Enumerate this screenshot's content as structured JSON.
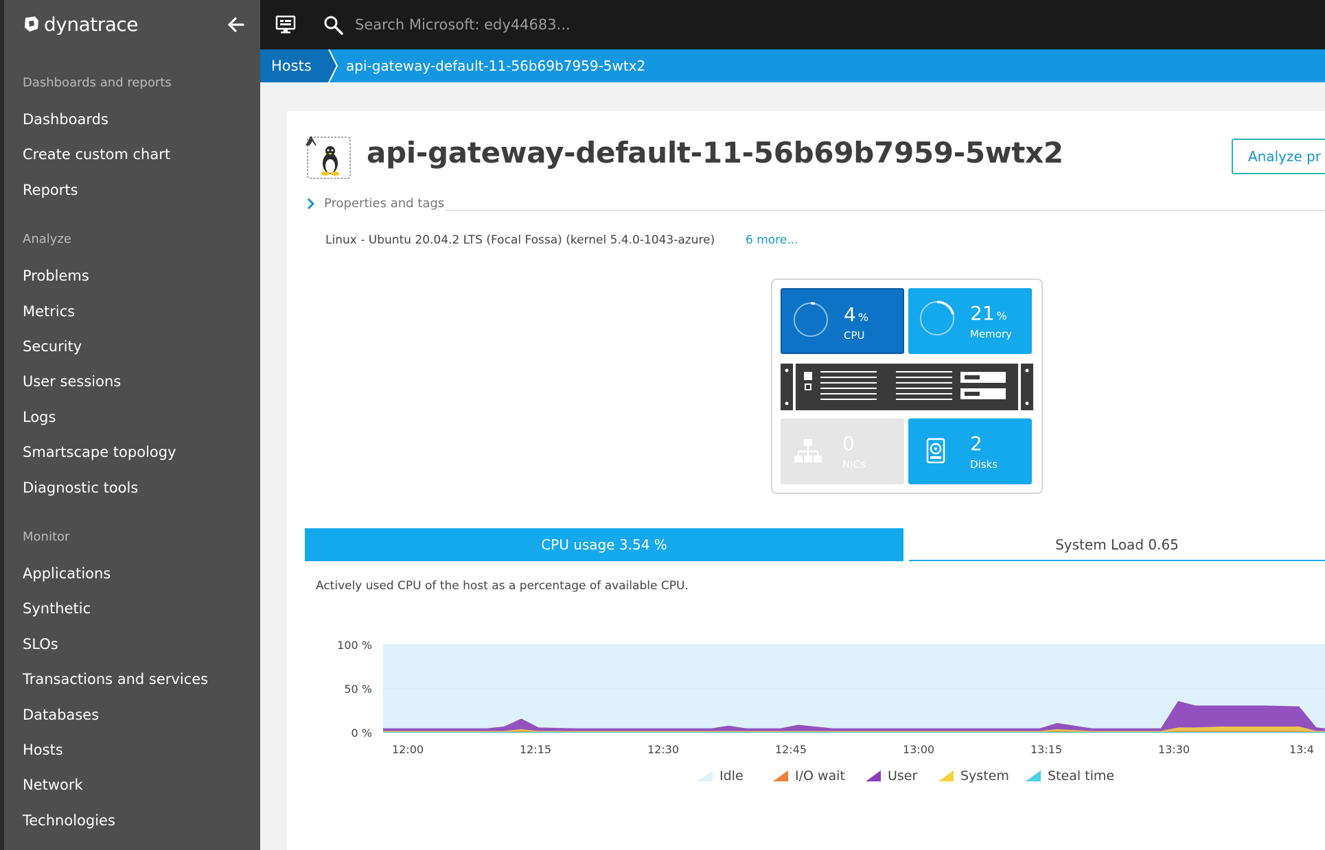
{
  "app": {
    "brand": "dynatrace"
  },
  "topbar": {
    "search_placeholder": "Search Microsoft: edy44683..."
  },
  "breadcrumb": {
    "root": "Hosts",
    "current": "api-gateway-default-11-56b69b7959-5wtx2"
  },
  "sidebar": {
    "sections": [
      {
        "title": "Dashboards and reports",
        "items": [
          "Dashboards",
          "Create custom chart",
          "Reports"
        ]
      },
      {
        "title": "Analyze",
        "items": [
          "Problems",
          "Metrics",
          "Security",
          "User sessions",
          "Logs",
          "Smartscape topology",
          "Diagnostic tools"
        ]
      },
      {
        "title": "Monitor",
        "items": [
          "Applications",
          "Synthetic",
          "SLOs",
          "Transactions and services",
          "Databases",
          "Hosts",
          "Network",
          "Technologies"
        ]
      }
    ]
  },
  "host": {
    "title": "api-gateway-default-11-56b69b7959-5wtx2",
    "analyze_button": "Analyze pr",
    "properties_label": "Properties and tags",
    "os_info": "Linux - Ubuntu 20.04.2 LTS (Focal Fossa) (kernel 5.4.0-1043-azure)",
    "more_link": "6 more..."
  },
  "infographic": {
    "cpu": {
      "value": "4",
      "unit": "%",
      "label": "CPU",
      "fraction": 0.04
    },
    "memory": {
      "value": "21",
      "unit": "%",
      "label": "Memory",
      "fraction": 0.21
    },
    "nics": {
      "value": "0",
      "label": "NICs"
    },
    "disks": {
      "value": "2",
      "label": "Disks"
    }
  },
  "tabs": {
    "cpu_usage": "CPU usage 3.54 %",
    "system_load": "System Load 0.65"
  },
  "cpu_description": "Actively used CPU of the host as a percentage of available CPU.",
  "colors": {
    "accent": "#14a8ec",
    "idle": "#dff1fa",
    "io_wait": "#f07f3c",
    "user": "#8b3fb8",
    "system": "#f5d33f",
    "steal": "#4dd0e1"
  },
  "chart_data": {
    "type": "area",
    "ylim": [
      0,
      100
    ],
    "y_ticks": [
      "100 %",
      "50 %",
      "0 %"
    ],
    "x_ticks": [
      "12:00",
      "12:15",
      "12:30",
      "12:45",
      "13:00",
      "13:15",
      "13:30",
      "13:4"
    ],
    "x": [
      "11:58",
      "12:00",
      "12:05",
      "12:10",
      "12:12",
      "12:14",
      "12:16",
      "12:20",
      "12:30",
      "12:36",
      "12:38",
      "12:40",
      "12:44",
      "12:46",
      "12:50",
      "13:00",
      "13:10",
      "13:14",
      "13:16",
      "13:20",
      "13:28",
      "13:30",
      "13:32",
      "13:35",
      "13:40",
      "13:44",
      "13:46",
      "13:50"
    ],
    "series": [
      {
        "name": "User",
        "values": [
          3,
          3,
          3,
          3,
          5,
          12,
          4,
          3,
          3,
          3,
          6,
          3,
          3,
          7,
          3,
          3,
          3,
          3,
          7,
          3,
          3,
          30,
          25,
          24,
          24,
          23,
          4,
          3
        ]
      },
      {
        "name": "System",
        "values": [
          1,
          1,
          1,
          1,
          1,
          2,
          1,
          1,
          1,
          1,
          1,
          1,
          1,
          1,
          1,
          1,
          1,
          1,
          2,
          1,
          1,
          4,
          4,
          5,
          5,
          5,
          1,
          1
        ]
      },
      {
        "name": "I/O wait",
        "values": [
          0,
          0,
          0,
          0,
          0,
          1,
          0,
          0,
          0,
          0,
          0,
          0,
          0,
          0,
          0,
          0,
          0,
          0,
          1,
          0,
          0,
          1,
          1,
          1,
          1,
          1,
          0,
          0
        ]
      },
      {
        "name": "Steal time",
        "values": [
          1,
          1,
          1,
          1,
          1,
          1,
          1,
          1,
          1,
          1,
          1,
          1,
          1,
          1,
          1,
          1,
          1,
          1,
          1,
          1,
          1,
          1,
          1,
          1,
          1,
          1,
          1,
          1
        ]
      }
    ],
    "legend": [
      "Idle",
      "I/O wait",
      "User",
      "System",
      "Steal time"
    ]
  }
}
